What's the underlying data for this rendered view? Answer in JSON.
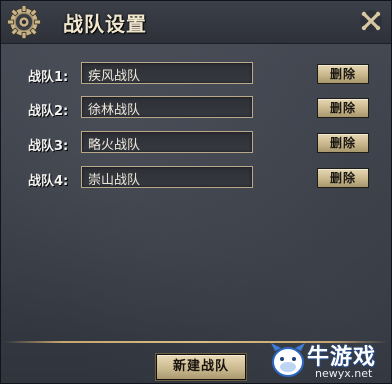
{
  "window": {
    "title": "战队设置"
  },
  "teams": [
    {
      "label": "战队1:",
      "value": "疾风战队"
    },
    {
      "label": "战队2:",
      "value": "徐林战队"
    },
    {
      "label": "战队3:",
      "value": "略火战队"
    },
    {
      "label": "战队4:",
      "value": "崇山战队"
    }
  ],
  "buttons": {
    "delete_label": "删除",
    "new_team_label": "新建战队"
  },
  "watermark": {
    "text": "牛游戏",
    "url": "newyx.net"
  },
  "colors": {
    "title_text": "#f1e7cf",
    "button_face": "#cdbb91",
    "divider": "#c4a470",
    "input_border": "#b9a98a"
  },
  "icons": {
    "title": "gear-icon",
    "close": "close-icon"
  }
}
